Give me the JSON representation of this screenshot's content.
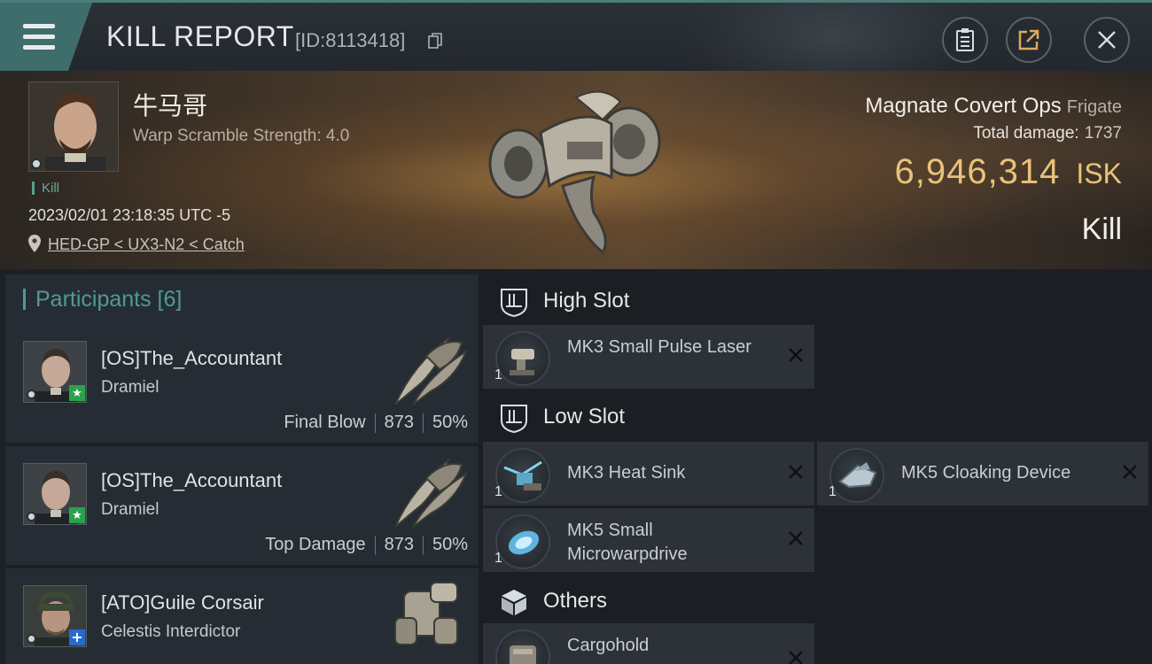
{
  "header": {
    "title": "KILL REPORT",
    "report_id": "[ID:8113418]"
  },
  "victim": {
    "name": "牛马哥",
    "warp_scramble": "Warp Scramble Strength: 4.0",
    "tag": "Kill",
    "timestamp": "2023/02/01 23:18:35 UTC -5",
    "location": "HED-GP < UX3-N2 < Catch",
    "ship_name": "Magnate Covert Ops",
    "ship_class": "Frigate",
    "total_damage_label": "Total damage:",
    "total_damage_value": "1737",
    "isk_value": "6,946,314",
    "isk_unit": "ISK",
    "result": "Kill"
  },
  "participants": {
    "label": "Participants [6]",
    "rows": [
      {
        "name": "[OS]The_Accountant",
        "ship": "Dramiel",
        "stat_label": "Final Blow",
        "damage": "873",
        "percent": "50%",
        "badge": "★"
      },
      {
        "name": "[OS]The_Accountant",
        "ship": "Dramiel",
        "stat_label": "Top Damage",
        "damage": "873",
        "percent": "50%",
        "badge": "★"
      },
      {
        "name": "[ATO]Guile Corsair",
        "ship": "Celestis Interdictor",
        "badge": "+"
      }
    ]
  },
  "fitting": {
    "high_slot": {
      "label": "High Slot",
      "modules": [
        {
          "name": "MK3 Small Pulse Laser",
          "qty": "1"
        }
      ]
    },
    "low_slot": {
      "label": "Low Slot",
      "modules": [
        {
          "name": "MK3 Heat Sink",
          "qty": "1"
        },
        {
          "name": "MK5 Cloaking Device",
          "qty": "1"
        },
        {
          "name": "MK5 Small Microwarpdrive",
          "qty": "1"
        }
      ]
    },
    "others": {
      "label": "Others",
      "modules": [
        {
          "name": "Cargohold"
        }
      ]
    }
  },
  "colors": {
    "accent_teal": "#4f9a95",
    "isk_gold": "#e9c27a",
    "final_blow_badge": "#2aa24b",
    "interdictor_badge": "#2a6ad0"
  },
  "icons": [
    "menu-icon",
    "copy-icon",
    "clipboard-icon",
    "share-icon",
    "close-icon",
    "location-pin-icon",
    "high-slot-icon",
    "low-slot-icon",
    "cube-icon",
    "remove-x-icon"
  ]
}
